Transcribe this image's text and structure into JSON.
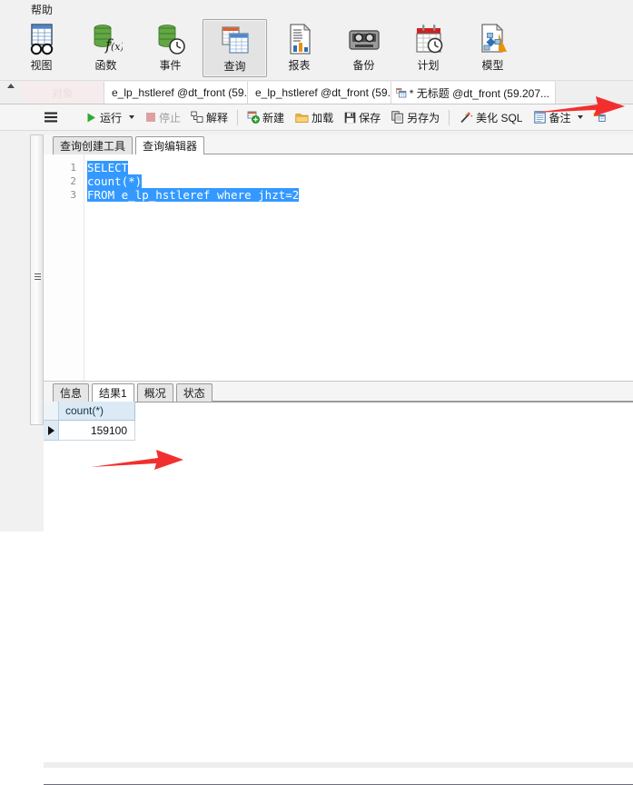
{
  "menubar": {
    "items": [
      {
        "label": "帮助",
        "name": "menu-help"
      }
    ]
  },
  "ribbon": {
    "items": [
      {
        "label": "视图",
        "icon": "view-icon",
        "active": false
      },
      {
        "label": "函数",
        "icon": "function-icon",
        "active": false
      },
      {
        "label": "事件",
        "icon": "event-icon",
        "active": false
      },
      {
        "label": "查询",
        "icon": "query-icon",
        "active": true
      },
      {
        "label": "报表",
        "icon": "report-icon",
        "active": false
      },
      {
        "label": "备份",
        "icon": "backup-icon",
        "active": false
      },
      {
        "label": "计划",
        "icon": "schedule-icon",
        "active": false
      },
      {
        "label": "模型",
        "icon": "model-icon",
        "active": false
      }
    ]
  },
  "tabstrip": {
    "object_label": "对象",
    "tabs": [
      {
        "title": "e_lp_hstleref @dt_front (59...",
        "icon": "table-design-icon",
        "active": false
      },
      {
        "title": "e_lp_hstleref @dt_front (59...",
        "icon": "table-data-icon",
        "active": false
      },
      {
        "title": "* 无标题 @dt_front (59.207...",
        "icon": "query-tab-icon",
        "active": true
      }
    ]
  },
  "toolbar": {
    "menu_button": "hamburger-icon",
    "buttons": [
      {
        "label": "运行",
        "icon": "run-icon",
        "dropdown": true,
        "disabled": false
      },
      {
        "label": "停止",
        "icon": "stop-icon",
        "dropdown": false,
        "disabled": true
      },
      {
        "label": "解释",
        "icon": "explain-icon",
        "dropdown": false,
        "disabled": false
      },
      {
        "label": "新建",
        "icon": "new-icon",
        "dropdown": false,
        "disabled": false
      },
      {
        "label": "加载",
        "icon": "load-icon",
        "dropdown": false,
        "disabled": false
      },
      {
        "label": "保存",
        "icon": "save-icon",
        "dropdown": false,
        "disabled": false
      },
      {
        "label": "另存为",
        "icon": "save-as-icon",
        "dropdown": false,
        "disabled": false
      },
      {
        "label": "美化 SQL",
        "icon": "beautify-icon",
        "dropdown": false,
        "disabled": false
      },
      {
        "label": "备注",
        "icon": "note-icon",
        "dropdown": true,
        "disabled": false
      }
    ]
  },
  "editor": {
    "subtabs": [
      {
        "label": "查询创建工具",
        "selected": false
      },
      {
        "label": "查询编辑器",
        "selected": true
      }
    ],
    "line_numbers": [
      "1",
      "2",
      "3"
    ],
    "lines": [
      {
        "text": "SELECT",
        "selected": true
      },
      {
        "text": "count(*)",
        "selected": true
      },
      {
        "text": "FROM e_lp_hstleref where jhzt=2",
        "selected": true
      }
    ]
  },
  "results": {
    "tabs": [
      {
        "label": "信息",
        "selected": false
      },
      {
        "label": "结果1",
        "selected": true
      },
      {
        "label": "概况",
        "selected": false
      },
      {
        "label": "状态",
        "selected": false
      }
    ],
    "columns": [
      "count(*)"
    ],
    "rows": [
      [
        "159100"
      ]
    ]
  },
  "annotations": {
    "arrows": [
      {
        "name": "arrow-toolbar",
        "color": "#f22f2f"
      },
      {
        "name": "arrow-result",
        "color": "#f22f2f"
      }
    ]
  },
  "colors": {
    "selection_blue": "#3399ff",
    "arrow_red": "#f22f2f",
    "ribbon_bg": "#f1f1f1",
    "grid_header": "#dceaf5"
  }
}
